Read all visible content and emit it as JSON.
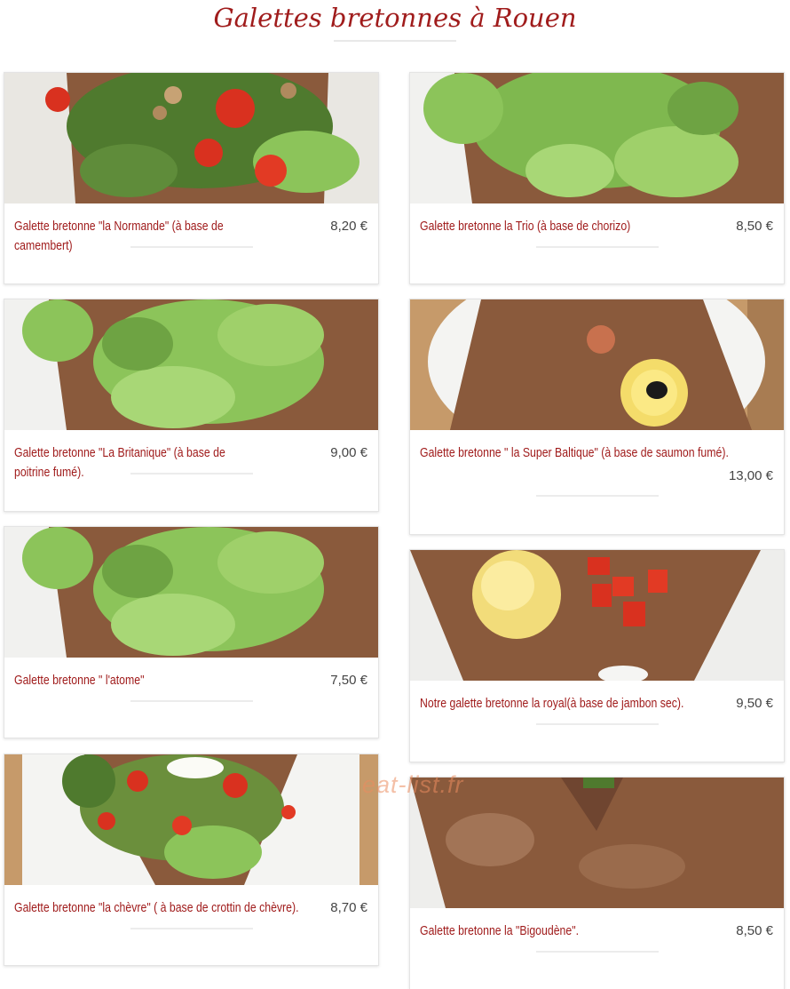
{
  "header": {
    "title": "Galettes bretonnes à Rouen"
  },
  "watermark": "eat-list.fr",
  "currency": "€",
  "items": [
    {
      "name": "Galette bretonne \"la Normande\" (à base de camembert)",
      "price": "8,20 €",
      "image": "galette-tomato-salad-image"
    },
    {
      "name": "Galette bretonne la Trio (à base de chorizo)",
      "price": "8,50 €",
      "image": "galette-lettuce-image"
    },
    {
      "name": "Galette bretonne \"La Britanique\" (à base de poitrine fumé).",
      "price": "9,00 €",
      "image": "galette-lettuce-image"
    },
    {
      "name": "Galette bretonne \" la Super Baltique\" (à base de saumon fumé).",
      "price": "13,00 €",
      "image": "galette-lemon-olive-image"
    },
    {
      "name": "Galette bretonne \" l'atome\"",
      "price": "7,50 €",
      "image": "galette-lettuce-image"
    },
    {
      "name": "Notre galette bretonne la royal(à base de jambon sec).",
      "price": "9,50 €",
      "image": "galette-potato-tomato-image"
    },
    {
      "name": "Galette bretonne \"la chèvre\" ( à base de crottin de chèvre).",
      "price": "8,70 €",
      "image": "galette-goat-cheese-image"
    },
    {
      "name": "Galette bretonne la \"Bigoudène\".",
      "price": "8,50 €",
      "image": "galette-plain-image"
    }
  ],
  "colors": {
    "title": "#a01c1c",
    "item_name": "#a01c1c",
    "price": "#444444",
    "galette": "#8a5a3c",
    "lettuce": "#8cc45a",
    "tomato": "#d9311f"
  }
}
